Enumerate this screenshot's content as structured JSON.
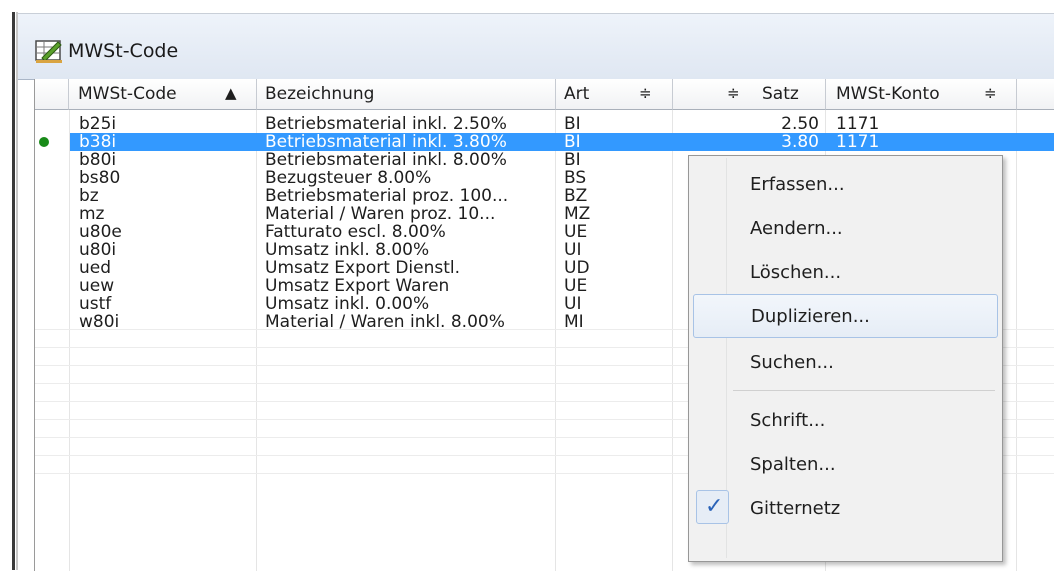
{
  "window": {
    "title": "MWSt-Code",
    "icon": "table-edit-icon"
  },
  "columns": [
    {
      "label": "MWSt-Code",
      "sort": "▲"
    },
    {
      "label": "Bezeichnung",
      "sort": ""
    },
    {
      "label": "Art",
      "sort": "≑"
    },
    {
      "label": "Satz",
      "sort": "≑"
    },
    {
      "label": "MWSt-Konto",
      "sort": "≑"
    }
  ],
  "rows": [
    {
      "code": "b25i",
      "bez": "Betriebsmaterial inkl. 2.50%",
      "art": "BI",
      "satz": "2.50",
      "konto": "1171"
    },
    {
      "code": "b38i",
      "bez": "Betriebsmaterial inkl. 3.80%",
      "art": "BI",
      "satz": "3.80",
      "konto": "1171"
    },
    {
      "code": "b80i",
      "bez": "Betriebsmaterial inkl. 8.00%",
      "art": "BI",
      "satz": "",
      "konto": ""
    },
    {
      "code": "bs80",
      "bez": "Bezugsteuer 8.00%",
      "art": "BS",
      "satz": "",
      "konto": ""
    },
    {
      "code": "bz",
      "bez": "Betriebsmaterial proz. 100...",
      "art": "BZ",
      "satz": "",
      "konto": ""
    },
    {
      "code": "mz",
      "bez": "Material / Waren proz. 10...",
      "art": "MZ",
      "satz": "",
      "konto": ""
    },
    {
      "code": "u80e",
      "bez": "Fatturato escl. 8.00%",
      "art": "UE",
      "satz": "",
      "konto": ""
    },
    {
      "code": "u80i",
      "bez": "Umsatz inkl. 8.00%",
      "art": "UI",
      "satz": "",
      "konto": ""
    },
    {
      "code": "ued",
      "bez": "Umsatz Export Dienstl.",
      "art": "UD",
      "satz": "",
      "konto": ""
    },
    {
      "code": "uew",
      "bez": "Umsatz Export Waren",
      "art": "UE",
      "satz": "",
      "konto": ""
    },
    {
      "code": "ustf",
      "bez": "Umsatz inkl. 0.00%",
      "art": "UI",
      "satz": "",
      "konto": ""
    },
    {
      "code": "w80i",
      "bez": "Material / Waren inkl. 8.00%",
      "art": "MI",
      "satz": "",
      "konto": ""
    }
  ],
  "context_menu": {
    "items": [
      {
        "label": "Erfassen..."
      },
      {
        "label": "Aendern..."
      },
      {
        "label": "Löschen..."
      },
      {
        "label": "Duplizieren..."
      },
      {
        "label": "Suchen..."
      },
      {
        "label": "Schrift..."
      },
      {
        "label": "Spalten..."
      },
      {
        "label": "Gitternetz",
        "checked": true
      }
    ],
    "check_glyph": "✓"
  },
  "colors": {
    "selection": "#3399ff",
    "active_dot": "#188a18"
  }
}
